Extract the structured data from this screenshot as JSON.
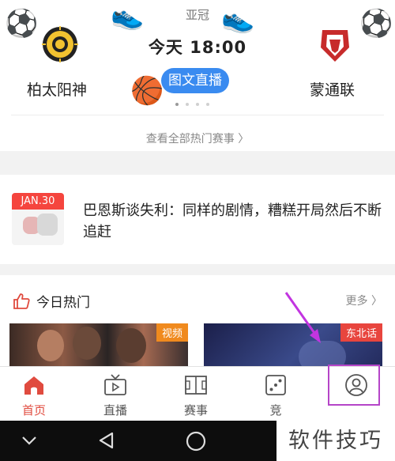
{
  "match": {
    "league": "亚冠",
    "time": "今天  18:00",
    "home_team": "柏太阳神",
    "away_team": "蒙通联",
    "live_label": "图文直播",
    "carousel_pages": 4,
    "carousel_active": 1
  },
  "all_matches_link": "查看全部热门赛事 〉",
  "news": {
    "date": "JAN.30",
    "title": "巴恩斯谈失利：同样的剧情，糟糕开局然后不断追赶"
  },
  "hot": {
    "title": "今日热门",
    "more": "更多",
    "items": [
      {
        "tag": "视频"
      },
      {
        "tag": "东北话"
      }
    ]
  },
  "tabs": [
    {
      "label": "首页",
      "icon": "home-icon",
      "active": true
    },
    {
      "label": "直播",
      "icon": "tv-icon",
      "active": false
    },
    {
      "label": "赛事",
      "icon": "field-icon",
      "active": false
    },
    {
      "label": "竞",
      "icon": "dice-icon",
      "active": false
    },
    {
      "label": "",
      "icon": "user-icon",
      "active": false
    }
  ],
  "watermark": "软件技巧",
  "colors": {
    "accent_red": "#e04b3f",
    "live_blue": "#3a8bf0",
    "highlight_purple": "#b545c8",
    "badge_red": "#f5453e"
  }
}
